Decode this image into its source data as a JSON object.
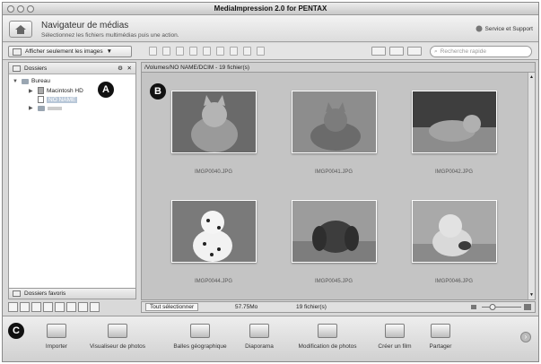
{
  "window": {
    "title": "MediaImpression 2.0 for PENTAX"
  },
  "header": {
    "title": "Navigateur de médias",
    "subtitle": "Sélectionnez les fichiers multimédias puis une action.",
    "service_label": "Service et Support"
  },
  "toolbar": {
    "filter_label": "Afficher seulement les images",
    "search_placeholder": "Recherche rapide"
  },
  "sidebar": {
    "header_label": "Dossiers",
    "tree": {
      "root": "Bureau",
      "drive": "Macintosh HD",
      "selected": "NO NAME"
    },
    "favorites_label": "Dossiers favoris"
  },
  "main": {
    "path": "/Volumes/NO NAME/DCIM - 19 fichier(s)",
    "files": [
      "IMGP0040.JPG",
      "IMGP0041.JPG",
      "IMGP0042.JPG",
      "IMGP0044.JPG",
      "IMGP0045.JPG",
      "IMGP0046.JPG"
    ]
  },
  "status": {
    "select_all": "Tout sélectionner",
    "size": "57.75Mo",
    "count": "19 fichier(s)"
  },
  "actions": [
    {
      "label": "Importer",
      "icon": "import-icon"
    },
    {
      "label": "Visualiseur de photos",
      "icon": "photo-viewer-icon"
    },
    {
      "label": "Balles géographique",
      "icon": "geo-icon"
    },
    {
      "label": "Diaporama",
      "icon": "slideshow-icon"
    },
    {
      "label": "Modification de photos",
      "icon": "photo-edit-icon"
    },
    {
      "label": "Créer un film",
      "icon": "film-icon"
    },
    {
      "label": "Partager",
      "icon": "share-icon"
    }
  ],
  "markers": {
    "a": "A",
    "b": "B",
    "c": "C"
  }
}
